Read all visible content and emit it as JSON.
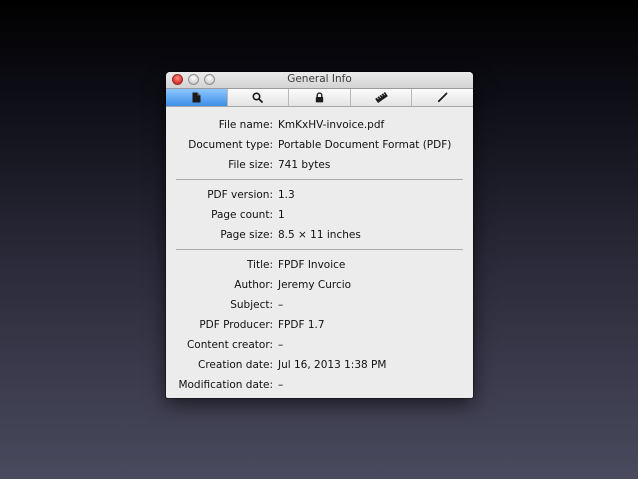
{
  "window": {
    "title": "General Info"
  },
  "toolbar": {
    "tabs": [
      {
        "icon": "document-icon",
        "active": true
      },
      {
        "icon": "magnifier-icon",
        "active": false
      },
      {
        "icon": "lock-icon",
        "active": false
      },
      {
        "icon": "ruler-icon",
        "active": false
      },
      {
        "icon": "pencil-icon",
        "active": false
      }
    ]
  },
  "file": {
    "name_label": "File name:",
    "name": "KmKxHV-invoice.pdf",
    "type_label": "Document type:",
    "type": "Portable Document Format (PDF)",
    "size_label": "File size:",
    "size": "741 bytes"
  },
  "pdf": {
    "version_label": "PDF version:",
    "version": "1.3",
    "page_count_label": "Page count:",
    "page_count": "1",
    "page_size_label": "Page size:",
    "page_size": "8.5 × 11 inches"
  },
  "meta": {
    "title_label": "Title:",
    "title": "FPDF Invoice",
    "author_label": "Author:",
    "author": "Jeremy Curcio",
    "subject_label": "Subject:",
    "subject": "–",
    "producer_label": "PDF Producer:",
    "producer": "FPDF 1.7",
    "creator_label": "Content creator:",
    "creator": "–",
    "created_label": "Creation date:",
    "created": "Jul 16, 2013 1:38 PM",
    "modified_label": "Modification date:",
    "modified": "–"
  }
}
